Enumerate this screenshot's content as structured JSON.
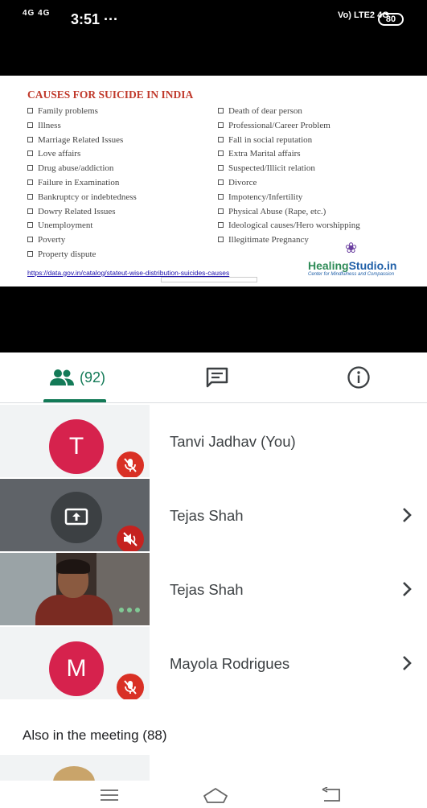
{
  "status_bar": {
    "signal": "4G 4G",
    "time": "3:51",
    "overflow": "···",
    "network": "Vo) LTE2 4G",
    "battery": "80"
  },
  "slide": {
    "title": "CAUSES FOR SUICIDE IN INDIA",
    "left_items": [
      "Family problems",
      "Illness",
      "Marriage Related Issues",
      "Love affairs",
      "Drug abuse/addiction",
      "Failure in Examination",
      "Bankruptcy or indebtedness",
      "Dowry Related Issues",
      "Unemployment",
      "Poverty",
      "Property dispute"
    ],
    "right_items": [
      "Death of dear person",
      "Professional/Career Problem",
      "Fall in social reputation",
      "Extra Marital affairs",
      "Suspected/Illicit relation",
      "Divorce",
      "Impotency/Infertility",
      "Physical Abuse (Rape, etc.)",
      "Ideological causes/Hero worshipping",
      "Illegitimate Pregnancy"
    ],
    "source_link": "https://data.gov.in/catalog/stateut-wise-distribution-suicides-causes",
    "logo": {
      "name_part1": "Healing",
      "name_part2": "Studio",
      "suffix": ".in",
      "tagline": "Center for Mindfulness and Compassion"
    }
  },
  "tabs": {
    "people_count": "(92)",
    "people_icon": "people-icon",
    "chat_icon": "chat-icon",
    "info_icon": "info-icon"
  },
  "participants": [
    {
      "initial": "T",
      "name": "Tanvi Jadhav (You)",
      "muted": true
    },
    {
      "name": "Tejas Shah",
      "presenting": true,
      "muted": true
    },
    {
      "name": "Tejas Shah",
      "video": true
    },
    {
      "initial": "M",
      "name": "Mayola Rodrigues",
      "muted": true
    }
  ],
  "also_in_meeting": "Also in the meeting (88)",
  "colors": {
    "accent": "#137a57",
    "avatar": "#d6224d",
    "mute": "#d93025",
    "slide_title": "#c0392b"
  }
}
